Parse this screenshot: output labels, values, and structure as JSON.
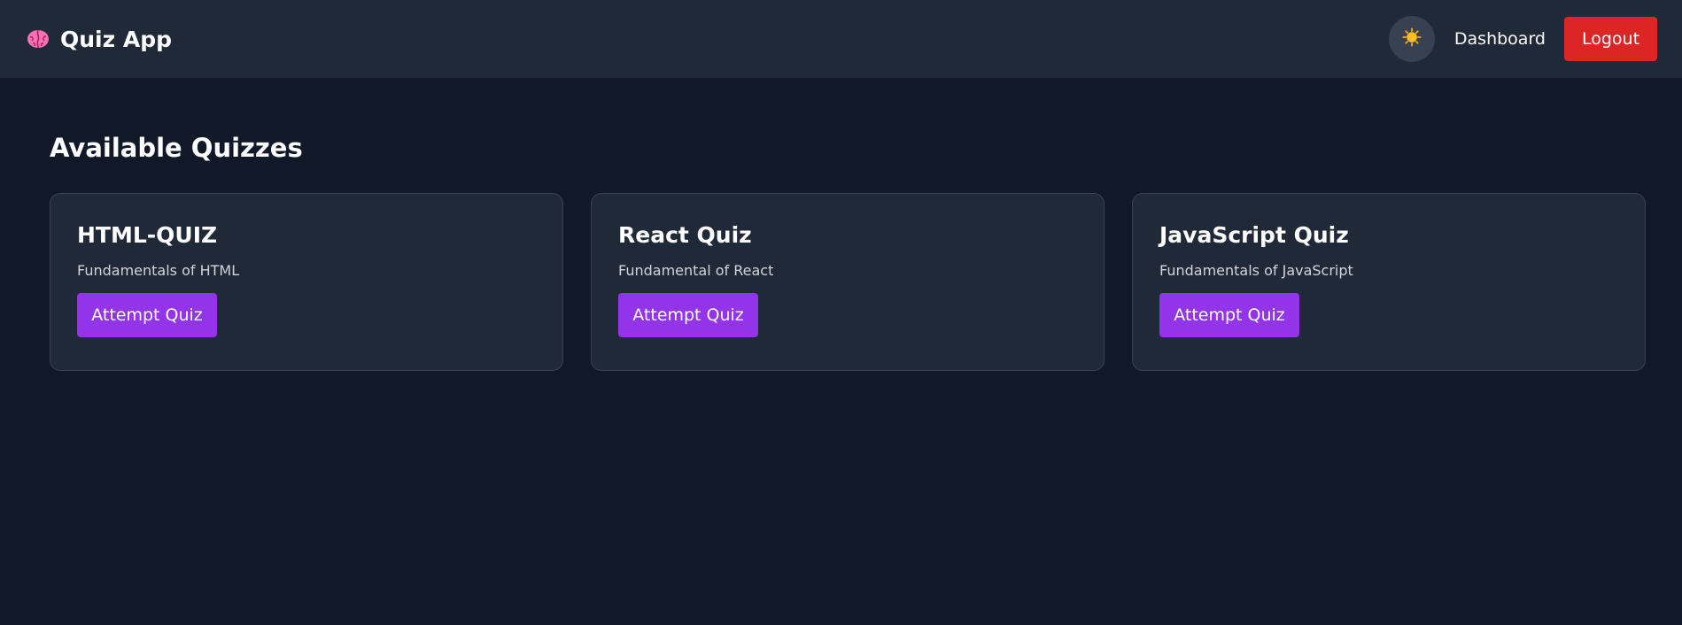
{
  "navbar": {
    "brand_icon": "brain-icon",
    "brand_title": "Quiz App",
    "theme_toggle_icon": "sun-icon",
    "dashboard_label": "Dashboard",
    "logout_label": "Logout"
  },
  "main": {
    "title": "Available Quizzes",
    "quizzes": [
      {
        "title": "HTML-QUIZ",
        "description": "Fundamentals of HTML",
        "button_label": "Attempt Quiz"
      },
      {
        "title": "React Quiz",
        "description": "Fundamental of React",
        "button_label": "Attempt Quiz"
      },
      {
        "title": "JavaScript Quiz",
        "description": "Fundamentals of JavaScript",
        "button_label": "Attempt Quiz"
      }
    ]
  },
  "colors": {
    "background": "#111827",
    "navbar": "#1f2937",
    "card": "#1f2937",
    "card_border": "#374151",
    "accent_purple": "#9333ea",
    "logout_red": "#dc2626",
    "toggle_bg": "#374151"
  }
}
